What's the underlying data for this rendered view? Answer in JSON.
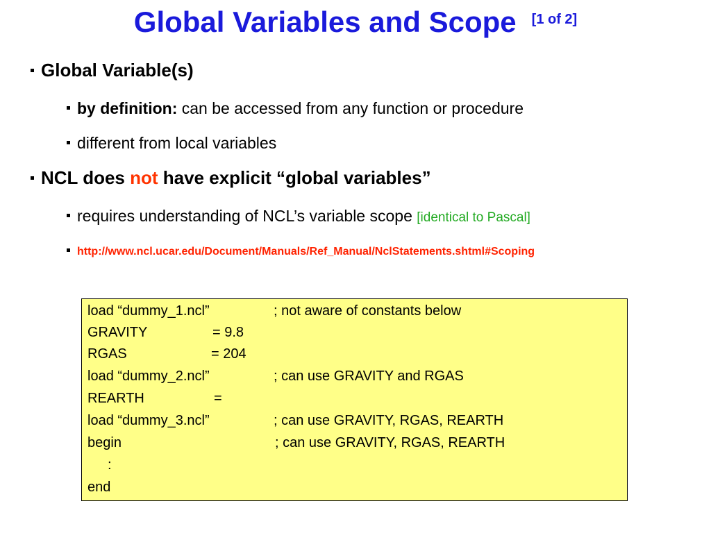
{
  "slide": {
    "title": "Global Variables and Scope",
    "title_part": "[1 of 2]",
    "bullets": [
      {
        "text": "Global Variable(s)"
      },
      {
        "bold_prefix": "by definition:",
        "text": " can be accessed from any function or  procedure"
      },
      {
        "text": "different from local variables"
      },
      {
        "text_a": "NCL does ",
        "highlight": "not",
        "text_b": " have explicit “global variables”"
      },
      {
        "text": "requires understanding of NCL’s variable scope ",
        "note": "[identical to Pascal]"
      },
      {
        "link": "http://www.ncl.ucar.edu/Document/Manuals/Ref_Manual/NclStatements.shtml#Scoping"
      }
    ],
    "code_lines": [
      {
        "code": "load “dummy_1.ncl”",
        "comment": "; not aware of constants below"
      },
      {
        "code": "GRAVITY",
        "comment": "= 9.8"
      },
      {
        "code": "RGAS",
        "comment": "= 204"
      },
      {
        "code": "load “dummy_2.ncl”",
        "comment": "; can use GRAVITY and RGAS"
      },
      {
        "code": "REARTH",
        "comment": "="
      },
      {
        "code": "load “dummy_3.ncl”",
        "comment": "; can use GRAVITY, RGAS, REARTH"
      },
      {
        "code": "begin",
        "comment": "; can use GRAVITY, RGAS, REARTH"
      },
      {
        "code": "    :",
        "comment": ""
      },
      {
        "code": "end",
        "comment": ""
      }
    ],
    "colors": {
      "title": "#1a1adb",
      "highlight": "#ff3300",
      "note": "#22aa22",
      "link": "#ff2200",
      "code_background": "#ffff88"
    }
  }
}
